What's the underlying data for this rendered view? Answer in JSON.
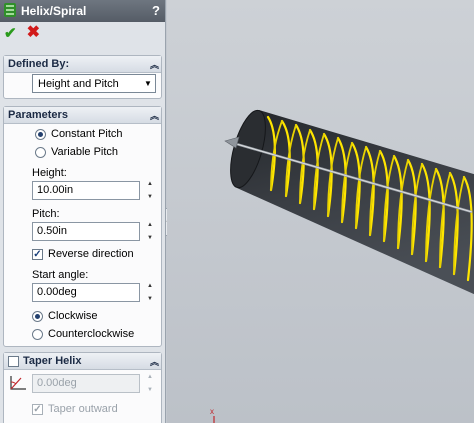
{
  "window": {
    "title": "Helix/Spiral",
    "help_label": "?"
  },
  "actions": {
    "ok_glyph": "✔",
    "cancel_glyph": "✖"
  },
  "defined_by": {
    "header": "Defined By:",
    "collapse_glyph": "︽",
    "selected": "Height and Pitch",
    "caret": "▼"
  },
  "parameters": {
    "header": "Parameters",
    "collapse_glyph": "︽",
    "pitch_mode": {
      "constant": "Constant Pitch",
      "variable": "Variable Pitch",
      "selected": "constant"
    },
    "height": {
      "label": "Height:",
      "value": "10.00in"
    },
    "pitch": {
      "label": "Pitch:",
      "value": "0.50in"
    },
    "reverse": {
      "label": "Reverse direction",
      "checked": true,
      "check_glyph": "✓"
    },
    "start_angle": {
      "label": "Start angle:",
      "value": "0.00deg"
    },
    "direction": {
      "clockwise": "Clockwise",
      "counterclockwise": "Counterclockwise",
      "selected": "clockwise"
    },
    "spin_up": "▲",
    "spin_down": "▼"
  },
  "taper": {
    "header": "Taper Helix",
    "collapse_glyph": "︽",
    "checked": false,
    "angle_value": "0.00deg",
    "taper_outward": {
      "label": "Taper outward",
      "checked": true,
      "check_glyph": "✓"
    }
  },
  "splitter_glyph": "◀",
  "icons": [
    "helix-feature-icon",
    "ok-check-icon",
    "cancel-x-icon",
    "collapse-chevron-icon",
    "taper-angle-icon",
    "coordinate-triad-icon"
  ],
  "colors": {
    "helix": "#ffe600",
    "cylinder": "#33363b",
    "header_text": "#1b2a44",
    "ok": "#2a9b1c",
    "cancel": "#d11a1a"
  }
}
